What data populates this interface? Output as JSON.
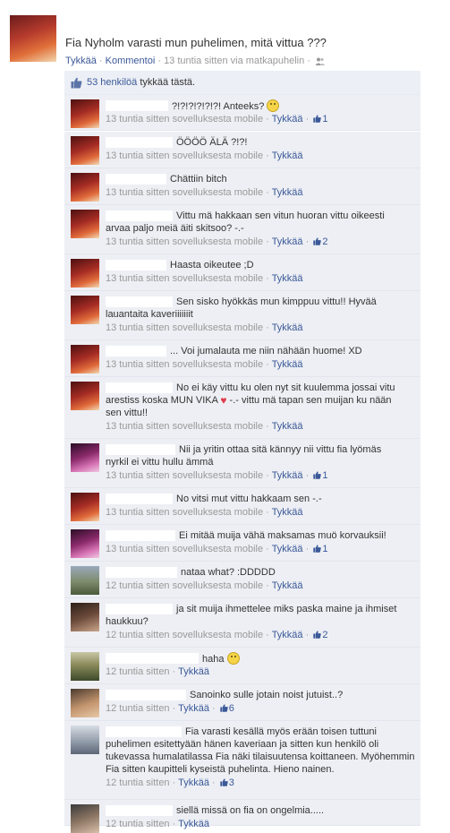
{
  "post": {
    "text": "Fia Nyholm varasti mun puhelimen, mitä vittua ???",
    "like_link": "Tykkää",
    "sep1": " · ",
    "comment_link": "Kommentoi",
    "sep2": " · ",
    "time_via": "13 tuntia sitten via matkapuhelin",
    "sep3": " · "
  },
  "likes": {
    "count_text": "53 henkilöä",
    "suffix": " tykkää tästä."
  },
  "comments": [
    {
      "avatar": "av-a",
      "name_w": 70,
      "text": "?!?!?!?!?!?! Anteeks?",
      "smiley": true,
      "time": "13 tuntia sitten sovelluksesta mobile",
      "like": "Tykkää",
      "likes": "1"
    },
    {
      "avatar": "av-a",
      "name_w": 75,
      "text": "ÖÖÖÖ ÄLÄ ?!?!",
      "time": "13 tuntia sitten sovelluksesta mobile",
      "like": "Tykkää"
    },
    {
      "avatar": "av-a",
      "name_w": 68,
      "text": "Chättiin bitch",
      "time": "13 tuntia sitten sovelluksesta mobile",
      "like": "Tykkää"
    },
    {
      "avatar": "av-a",
      "name_w": 75,
      "text": "Vittu mä hakkaan sen vitun huoran vittu oikeesti",
      "text2": "arvaa paljo meiä äiti skitsoo? -.-",
      "time": "13 tuntia sitten sovelluksesta mobile",
      "like": "Tykkää",
      "likes": "2"
    },
    {
      "avatar": "av-a",
      "name_w": 68,
      "text": "Haasta oikeutee ;D",
      "time": "13 tuntia sitten sovelluksesta mobile",
      "like": "Tykkää"
    },
    {
      "avatar": "av-a",
      "name_w": 75,
      "text": "Sen sisko hyökkäs mun kimppuu vittu!! Hyvää",
      "text2": "lauantaita kaveriiiiiiit",
      "time": "13 tuntia sitten sovelluksesta mobile",
      "like": "Tykkää"
    },
    {
      "avatar": "av-a",
      "name_w": 68,
      "text": "... Voi jumalauta me niin nähään huome! XD",
      "time": "13 tuntia sitten sovelluksesta mobile",
      "like": "Tykkää"
    },
    {
      "avatar": "av-a",
      "name_w": 75,
      "text": "No ei käy vittu ku olen nyt sit kuulemma jossai vitu",
      "text2a": "arestiss koska MUN VIKA ",
      "heart": true,
      "text2b": " -.- vittu mä tapan sen muijan ku nään",
      "text3": "sen vittu!!",
      "time": "13 tuntia sitten sovelluksesta mobile",
      "like": "Tykkää"
    },
    {
      "avatar": "av-b",
      "name_w": 78,
      "text": "Nii ja yritin ottaa sitä kännyy nii vittu fia lyömäs",
      "text2": "nyrkil ei vittu hullu ämmä",
      "time": "13 tuntia sitten sovelluksesta mobile",
      "like": "Tykkää",
      "likes": "1"
    },
    {
      "avatar": "av-a",
      "name_w": 75,
      "text": "No vitsi mut vittu hakkaam sen -.-",
      "time": "13 tuntia sitten sovelluksesta mobile",
      "like": "Tykkää"
    },
    {
      "avatar": "av-b",
      "name_w": 78,
      "text": "Ei mitää muija vähä maksamas muö korvauksii!",
      "time": "13 tuntia sitten sovelluksesta mobile",
      "like": "Tykkää",
      "likes": "1"
    },
    {
      "avatar": "av-c",
      "name_w": 80,
      "text": "nataa what? :DDDDD",
      "time": "12 tuntia sitten sovelluksesta mobile",
      "like": "Tykkää"
    },
    {
      "avatar": "av-d",
      "name_w": 75,
      "text": "ja sit muija ihmettelee miks paska maine ja ihmiset",
      "text2": "haukkuu?",
      "time": "12 tuntia sitten sovelluksesta mobile",
      "like": "Tykkää",
      "likes": "2"
    },
    {
      "avatar": "av-e",
      "name_w": 104,
      "text": "haha",
      "smiley": true,
      "time": "12 tuntia sitten",
      "like": "Tykkää"
    },
    {
      "avatar": "av-f",
      "name_w": 90,
      "text": "Sanoinko sulle jotain noist jutuist..?",
      "time": "12 tuntia sitten",
      "like": "Tykkää",
      "likes": "6"
    },
    {
      "avatar": "av-g",
      "name_w": 85,
      "text": "Fia varasti kesällä myös erään toisen tuttuni",
      "text2": "puhelimen esitettyään hänen kaveriaan ja sitten kun henkilö oli",
      "text3": "tukevassa humalatilassa Fia näki tilaisuutensa koittaneen. Myöhemmin",
      "text4": "Fia sitten kaupitteli kyseistä puhelinta. Hieno nainen.",
      "time": "12 tuntia sitten",
      "like": "Tykkää",
      "likes": "3"
    },
    {
      "avatar": "av-h",
      "name_w": 75,
      "text": "siellä missä on fia on ongelmia.....",
      "time": "12 tuntia sitten",
      "like": "Tykkää"
    }
  ]
}
